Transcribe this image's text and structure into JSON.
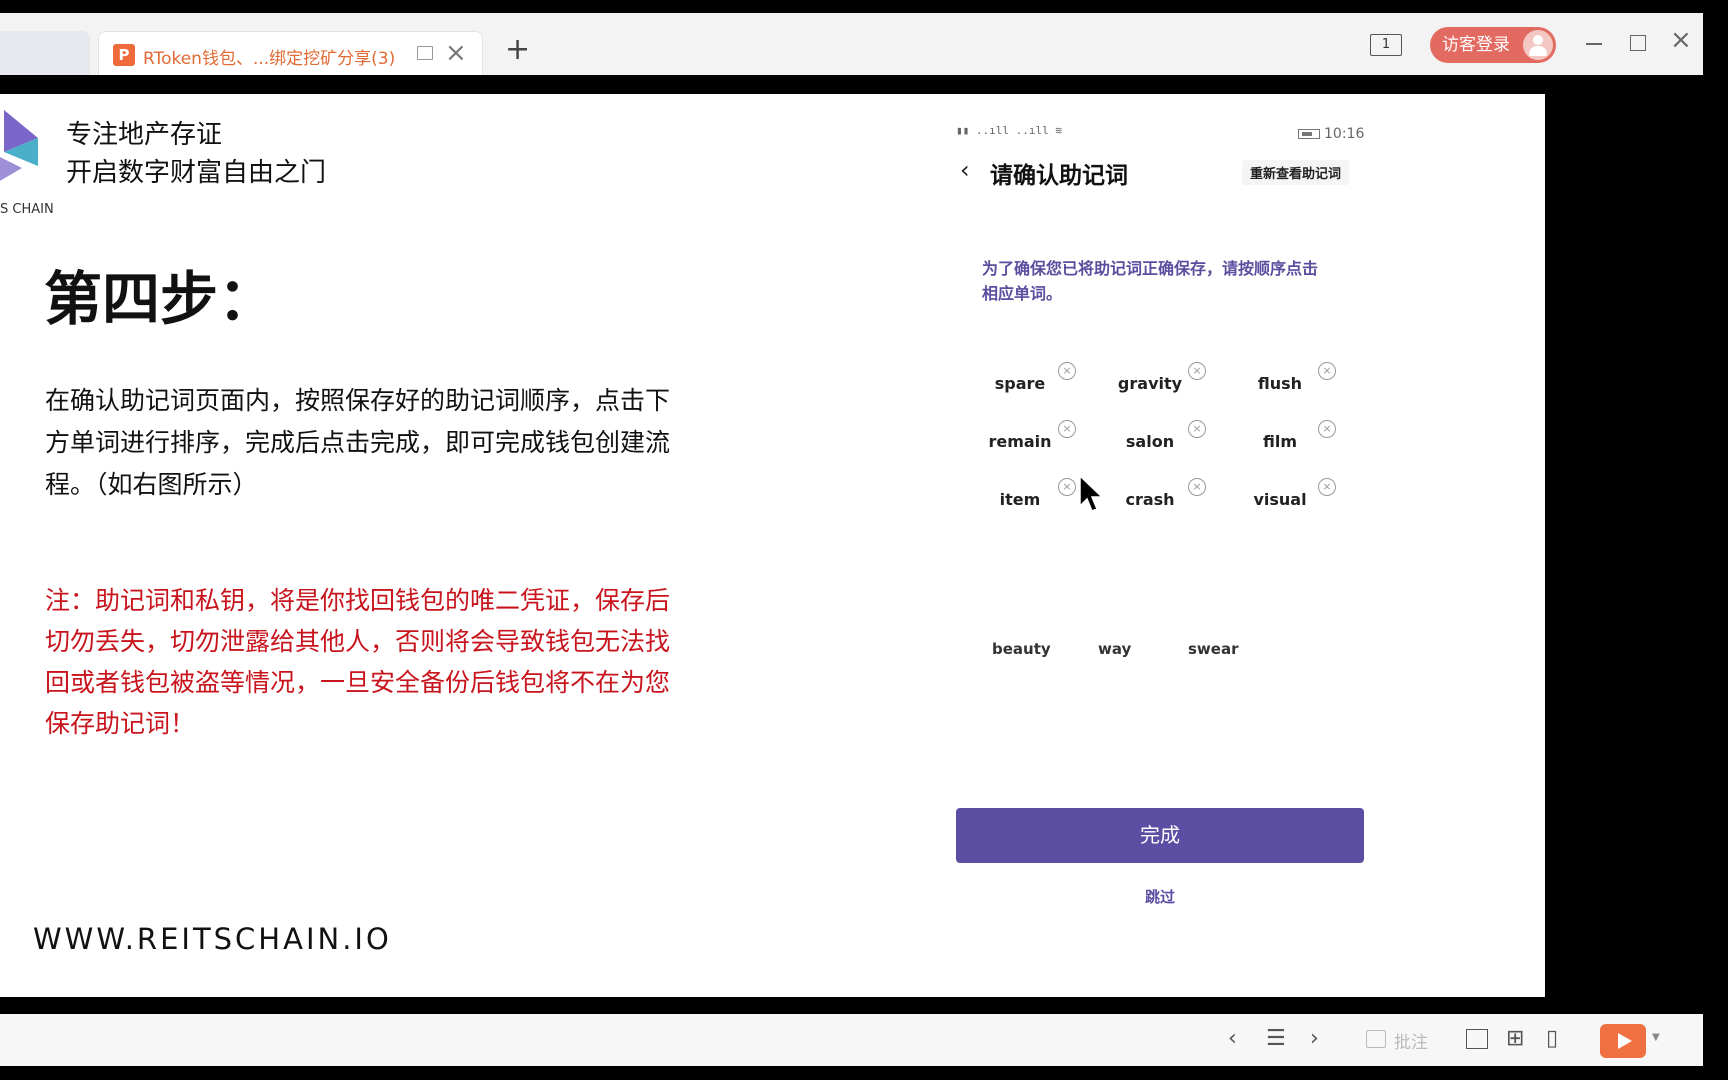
{
  "browser": {
    "tab_title": "RToken钱包、...绑定挖矿分享(3)",
    "tab_icon_letter": "P",
    "new_tab_label": "+",
    "page_counter": "1",
    "login_label": "访客登录"
  },
  "slide": {
    "slogan_line1": "专注地产存证",
    "slogan_line2": "开启数字财富自由之门",
    "logo_text": "S CHAIN",
    "step_title": "第四步：",
    "body": "在确认助记词页面内，按照保存好的助记词顺序，点击下方单词进行排序，完成后点击完成，即可完成钱包创建流程。（如右图所示）",
    "note": "注：助记词和私钥，将是你找回钱包的唯二凭证，保存后切勿丢失，切勿泄露给其他人，否则将会导致钱包无法找回或者钱包被盗等情况，一旦安全备份后钱包将不在为您保存助记词！",
    "website": "WWW.REITSCHAIN.IO"
  },
  "phone": {
    "status_time": "10:16",
    "title": "请确认助记词",
    "review_button": "重新查看助记词",
    "description": "为了确保您已将助记词正确保存，请按顺序点击相应单词。",
    "selected_words": [
      "spare",
      "gravity",
      "flush",
      "remain",
      "salon",
      "film",
      "item",
      "crash",
      "visual"
    ],
    "option_words": [
      "beauty",
      "way",
      "swear"
    ],
    "done_button": "完成",
    "skip_link": "跳过"
  },
  "bottom_bar": {
    "annotate_label": "批注"
  },
  "colors": {
    "accent": "#5b4ea3",
    "note_red": "#c8141c",
    "tab_orange": "#e16b35",
    "login_red": "#e36a60"
  }
}
